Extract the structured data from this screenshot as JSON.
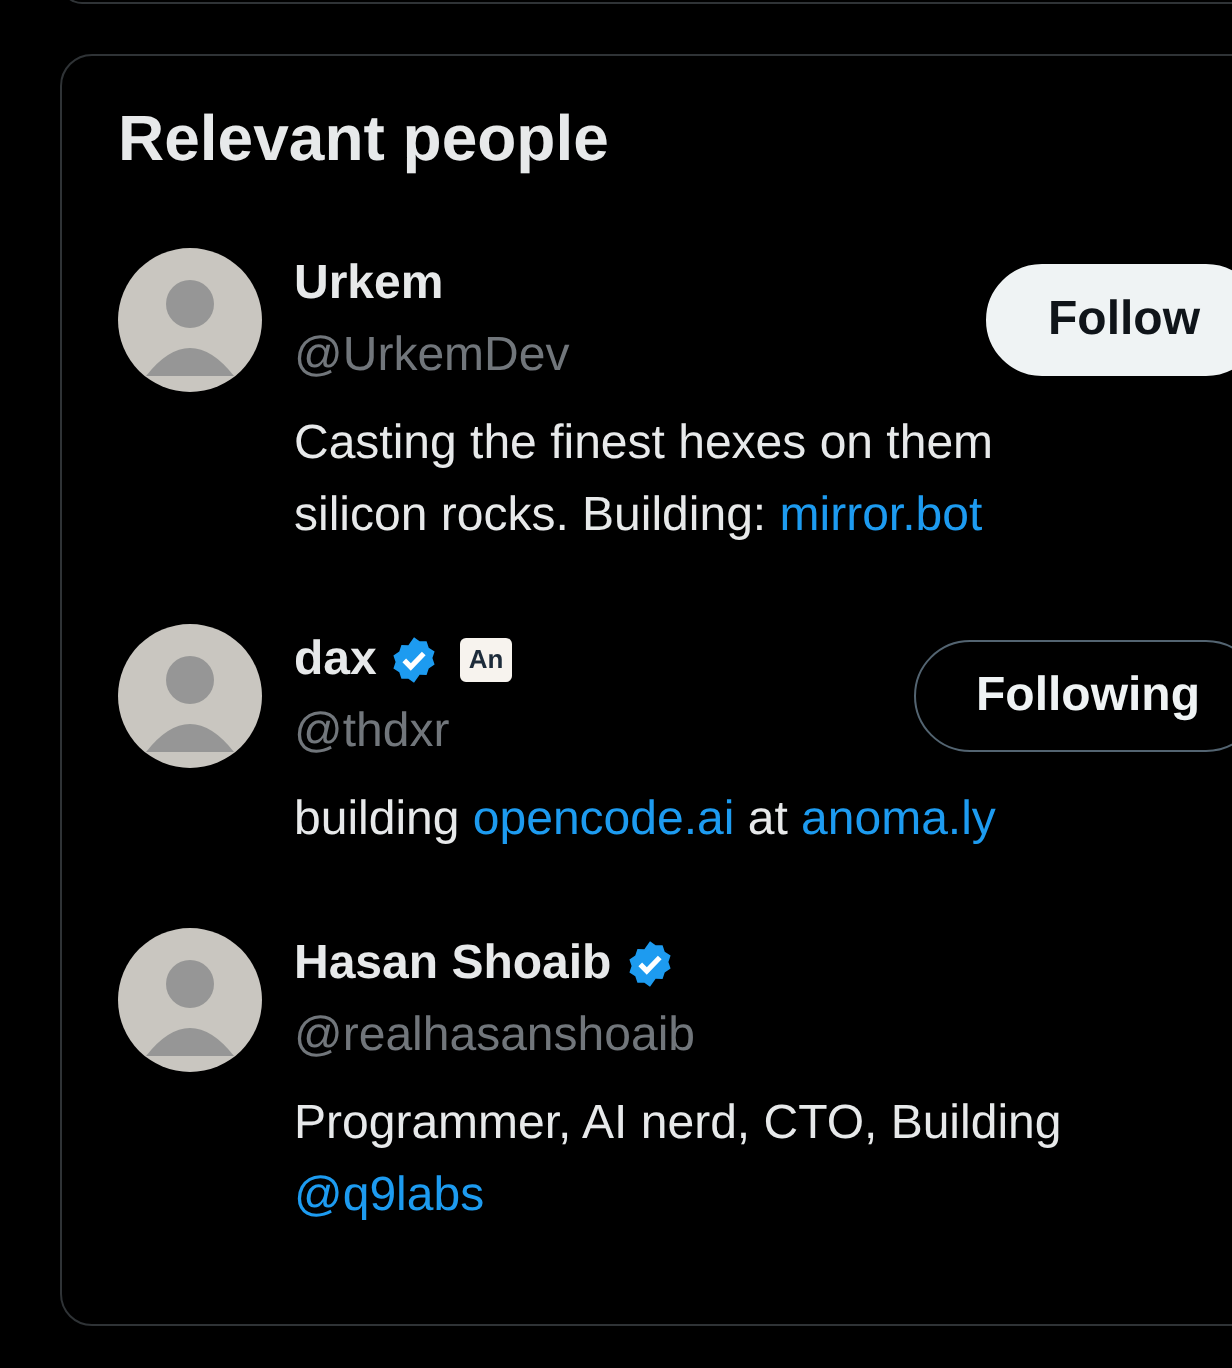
{
  "panel": {
    "title": "Relevant people"
  },
  "people": [
    {
      "name": "Urkem",
      "handle": "@UrkemDev",
      "verified": false,
      "button": {
        "label": "Follow",
        "following": false
      },
      "bio": [
        {
          "kind": "text",
          "text": "Casting the finest hexes on them silicon rocks. Building: "
        },
        {
          "kind": "link",
          "text": "mirror.bot"
        }
      ]
    },
    {
      "name": "dax",
      "handle": "@thdxr",
      "verified": true,
      "affiliate": "An",
      "button": {
        "label": "Following",
        "following": true
      },
      "bio": [
        {
          "kind": "text",
          "text": "building "
        },
        {
          "kind": "link",
          "text": "opencode.ai"
        },
        {
          "kind": "text",
          "text": " at "
        },
        {
          "kind": "link",
          "text": "anoma.ly"
        }
      ]
    },
    {
      "name": "Hasan Shoaib",
      "handle": "@realhasanshoaib",
      "verified": true,
      "bio": [
        {
          "kind": "text",
          "text": "Programmer, AI nerd, CTO, Building "
        },
        {
          "kind": "link",
          "text": "@q9labs"
        }
      ]
    }
  ]
}
